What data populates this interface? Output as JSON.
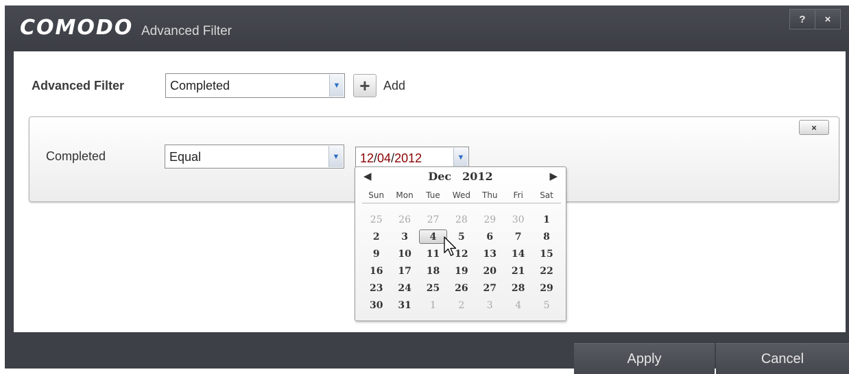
{
  "titlebar": {
    "logo": "COMODO",
    "title": "Advanced Filter",
    "help_label": "?",
    "close_label": "×"
  },
  "filter": {
    "label": "Advanced Filter",
    "selected": "Completed",
    "add_label": "Add"
  },
  "condition": {
    "field_label": "Completed",
    "operator": "Equal",
    "date": {
      "month": "12",
      "day": "04",
      "year": "2012"
    },
    "remove_label": "×"
  },
  "calendar": {
    "month": "Dec",
    "year": "2012",
    "prev_icon": "◀",
    "next_icon": "▶",
    "weekdays": [
      "Sun",
      "Mon",
      "Tue",
      "Wed",
      "Thu",
      "Fri",
      "Sat"
    ],
    "weeks": [
      [
        {
          "d": "25",
          "o": true
        },
        {
          "d": "26",
          "o": true
        },
        {
          "d": "27",
          "o": true
        },
        {
          "d": "28",
          "o": true
        },
        {
          "d": "29",
          "o": true
        },
        {
          "d": "30",
          "o": true
        },
        {
          "d": "1"
        }
      ],
      [
        {
          "d": "2"
        },
        {
          "d": "3"
        },
        {
          "d": "4",
          "sel": true
        },
        {
          "d": "5"
        },
        {
          "d": "6"
        },
        {
          "d": "7"
        },
        {
          "d": "8"
        }
      ],
      [
        {
          "d": "9"
        },
        {
          "d": "10"
        },
        {
          "d": "11"
        },
        {
          "d": "12"
        },
        {
          "d": "13"
        },
        {
          "d": "14"
        },
        {
          "d": "15"
        }
      ],
      [
        {
          "d": "16"
        },
        {
          "d": "17"
        },
        {
          "d": "18"
        },
        {
          "d": "19"
        },
        {
          "d": "20"
        },
        {
          "d": "21"
        },
        {
          "d": "22"
        }
      ],
      [
        {
          "d": "23"
        },
        {
          "d": "24"
        },
        {
          "d": "25"
        },
        {
          "d": "26"
        },
        {
          "d": "27"
        },
        {
          "d": "28"
        },
        {
          "d": "29"
        }
      ],
      [
        {
          "d": "30"
        },
        {
          "d": "31"
        },
        {
          "d": "1",
          "o": true
        },
        {
          "d": "2",
          "o": true
        },
        {
          "d": "3",
          "o": true
        },
        {
          "d": "4",
          "o": true
        },
        {
          "d": "5",
          "o": true
        }
      ]
    ]
  },
  "footer": {
    "apply_label": "Apply",
    "cancel_label": "Cancel"
  }
}
